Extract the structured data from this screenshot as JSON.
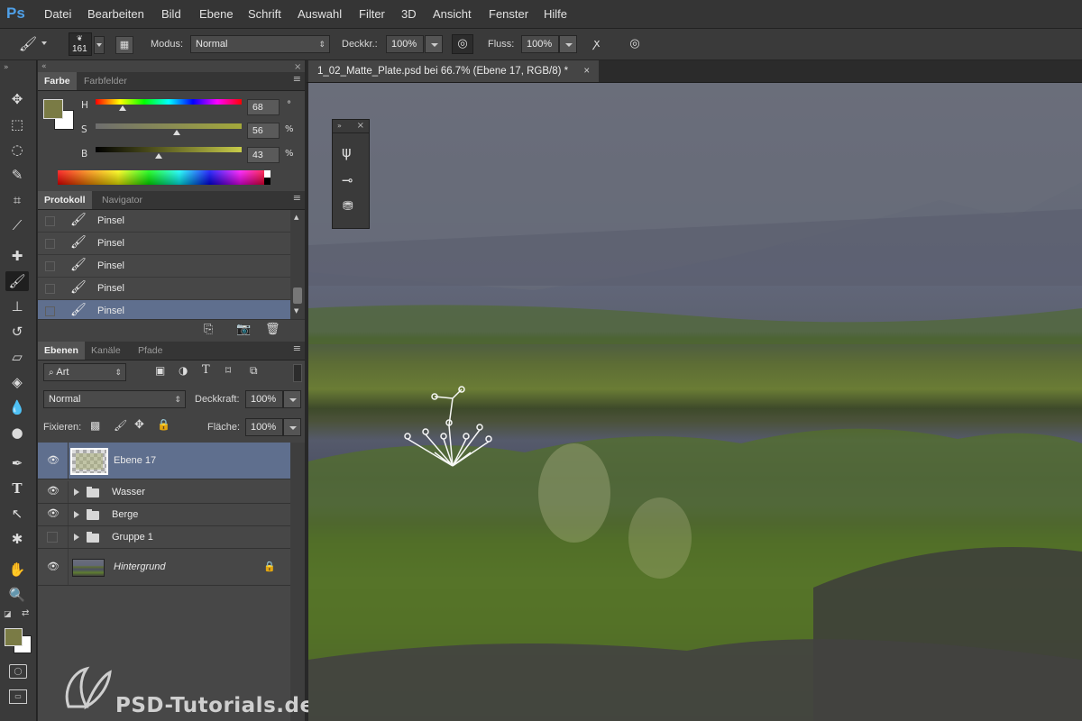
{
  "app": {
    "logo": "Ps",
    "menu": [
      "Datei",
      "Bearbeiten",
      "Bild",
      "Ebene",
      "Schrift",
      "Auswahl",
      "Filter",
      "3D",
      "Ansicht",
      "Fenster",
      "Hilfe"
    ]
  },
  "options_bar": {
    "brush_size": "161",
    "mode_label": "Modus:",
    "mode_value": "Normal",
    "opacity_label": "Deckkr.:",
    "opacity_value": "100%",
    "flow_label": "Fluss:",
    "flow_value": "100%"
  },
  "color_panel": {
    "tabs": [
      "Farbe",
      "Farbfelder"
    ],
    "h_label": "H",
    "h_value": "68",
    "h_unit": "°",
    "s_label": "S",
    "s_value": "56",
    "s_unit": "%",
    "b_label": "B",
    "b_value": "43",
    "b_unit": "%",
    "h_fraction": 0.19,
    "s_fraction": 0.56,
    "b_fraction": 0.43,
    "foreground_color": "#7a7b45",
    "background_color": "#ffffff"
  },
  "history_panel": {
    "tabs": [
      "Protokoll",
      "Navigator"
    ],
    "items": [
      "Pinsel",
      "Pinsel",
      "Pinsel",
      "Pinsel",
      "Pinsel"
    ],
    "active_index": 4
  },
  "layers_panel": {
    "tabs": [
      "Ebenen",
      "Kanäle",
      "Pfade"
    ],
    "filter_value": "Art",
    "blend_mode": "Normal",
    "opacity_label": "Deckkraft:",
    "opacity_value": "100%",
    "lock_label": "Fixieren:",
    "fill_label": "Fläche:",
    "fill_value": "100%",
    "layers": [
      {
        "name": "Ebene 17",
        "visible": true,
        "type": "layer",
        "selected": true
      },
      {
        "name": "Wasser",
        "visible": true,
        "type": "group"
      },
      {
        "name": "Berge",
        "visible": true,
        "type": "group"
      },
      {
        "name": "Gruppe 1",
        "visible": false,
        "type": "group"
      },
      {
        "name": "Hintergrund",
        "visible": true,
        "type": "background",
        "locked": true
      }
    ]
  },
  "document": {
    "tab_title": "1_02_Matte_Plate.psd bei 66.7% (Ebene 17, RGB/8) *"
  },
  "watermark": "PSD-Tutorials.de",
  "colors": {
    "accent_selection": "#5f6f8e",
    "ps_logo": "#4fa0e8"
  }
}
